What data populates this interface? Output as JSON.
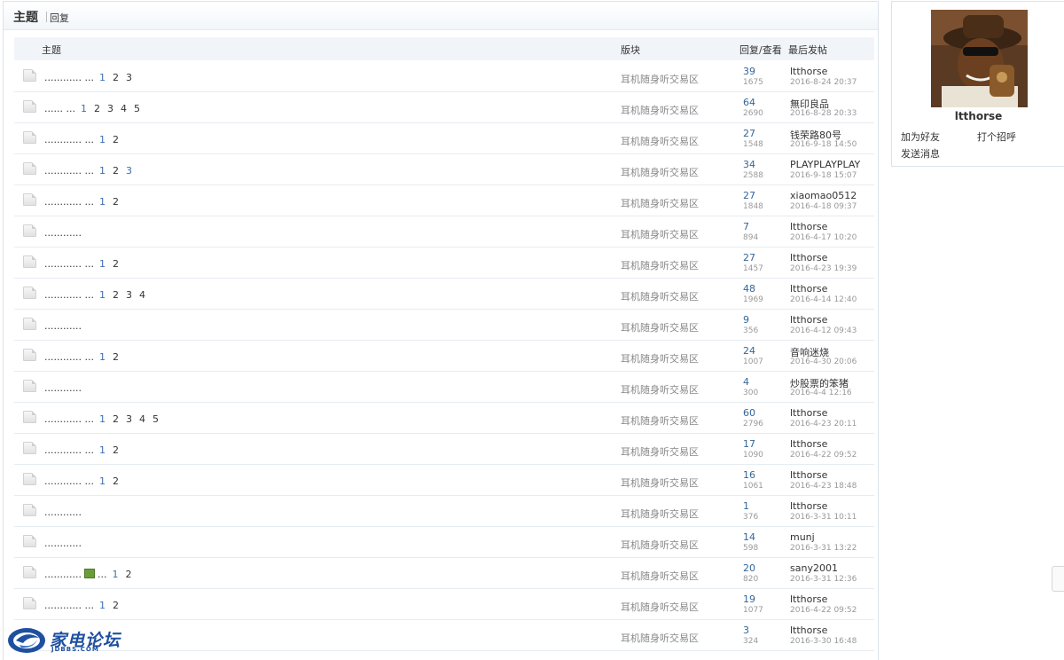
{
  "tabs": {
    "topic": "主题",
    "reply": "回复"
  },
  "columns": {
    "subject": "主题",
    "forum": "版块",
    "stats": "回复/查看",
    "last_post": "最后发帖"
  },
  "threads": [
    {
      "title": "............ ...",
      "pages": [
        "1",
        "2",
        "3"
      ],
      "forum": "耳机随身听交易区",
      "replies": "39",
      "views": "1675",
      "author": "ltthorse",
      "date": "2016-8-24 20:37"
    },
    {
      "title": "...... ...",
      "pages": [
        "1",
        "2",
        "3",
        "4",
        "5"
      ],
      "forum": "耳机随身听交易区",
      "replies": "64",
      "views": "2690",
      "author": "無印良品",
      "date": "2016-8-28 20:33"
    },
    {
      "title": "............ ...",
      "pages": [
        "1",
        "2"
      ],
      "forum": "耳机随身听交易区",
      "replies": "27",
      "views": "1548",
      "author": "钱荣路80号",
      "date": "2016-9-18 14:50"
    },
    {
      "title": "............ ...",
      "pages": [
        "1",
        "2",
        "3"
      ],
      "forum": "耳机随身听交易区",
      "replies": "34",
      "views": "2588",
      "author": "PLAYPLAYPLAY",
      "date": "2016-9-18 15:07"
    },
    {
      "title": "............ ...",
      "pages": [
        "1",
        "2"
      ],
      "forum": "耳机随身听交易区",
      "replies": "27",
      "views": "1848",
      "author": "xiaomao0512",
      "date": "2016-4-18 09:37"
    },
    {
      "title": "............",
      "pages": [],
      "forum": "耳机随身听交易区",
      "replies": "7",
      "views": "894",
      "author": "ltthorse",
      "date": "2016-4-17 10:20"
    },
    {
      "title": "............ ...",
      "pages": [
        "1",
        "2"
      ],
      "forum": "耳机随身听交易区",
      "replies": "27",
      "views": "1457",
      "author": "ltthorse",
      "date": "2016-4-23 19:39"
    },
    {
      "title": "............ ...",
      "pages": [
        "1",
        "2",
        "3",
        "4"
      ],
      "forum": "耳机随身听交易区",
      "replies": "48",
      "views": "1969",
      "author": "ltthorse",
      "date": "2016-4-14 12:40"
    },
    {
      "title": "............",
      "pages": [],
      "forum": "耳机随身听交易区",
      "replies": "9",
      "views": "356",
      "author": "ltthorse",
      "date": "2016-4-12 09:43"
    },
    {
      "title": "............ ...",
      "pages": [
        "1",
        "2"
      ],
      "forum": "耳机随身听交易区",
      "replies": "24",
      "views": "1007",
      "author": "音响迷烧",
      "date": "2016-4-30 20:06"
    },
    {
      "title": "............",
      "pages": [],
      "forum": "耳机随身听交易区",
      "replies": "4",
      "views": "300",
      "author": "炒股票的笨猪",
      "date": "2016-4-4 12:16"
    },
    {
      "title": "............ ...",
      "pages": [
        "1",
        "2",
        "3",
        "4",
        "5"
      ],
      "forum": "耳机随身听交易区",
      "replies": "60",
      "views": "2796",
      "author": "ltthorse",
      "date": "2016-4-23 20:11"
    },
    {
      "title": "............ ...",
      "pages": [
        "1",
        "2"
      ],
      "forum": "耳机随身听交易区",
      "replies": "17",
      "views": "1090",
      "author": "ltthorse",
      "date": "2016-4-22 09:52"
    },
    {
      "title": "............ ...",
      "pages": [
        "1",
        "2"
      ],
      "forum": "耳机随身听交易区",
      "replies": "16",
      "views": "1061",
      "author": "ltthorse",
      "date": "2016-4-23 18:48"
    },
    {
      "title": "............",
      "pages": [],
      "forum": "耳机随身听交易区",
      "replies": "1",
      "views": "376",
      "author": "ltthorse",
      "date": "2016-3-31 10:11"
    },
    {
      "title": "............",
      "pages": [],
      "forum": "耳机随身听交易区",
      "replies": "14",
      "views": "598",
      "author": "munj",
      "date": "2016-3-31 13:22"
    },
    {
      "title": "............",
      "title_after": "...",
      "attachment": true,
      "pages": [
        "1",
        "2"
      ],
      "forum": "耳机随身听交易区",
      "replies": "20",
      "views": "820",
      "author": "sany2001",
      "date": "2016-3-31 12:36"
    },
    {
      "title": "............ ...",
      "pages": [
        "1",
        "2"
      ],
      "forum": "耳机随身听交易区",
      "replies": "19",
      "views": "1077",
      "author": "ltthorse",
      "date": "2016-4-22 09:52"
    },
    {
      "title": "",
      "pages": [],
      "forum": "耳机随身听交易区",
      "replies": "3",
      "views": "324",
      "author": "ltthorse",
      "date": "2016-3-30 16:48"
    }
  ],
  "profile": {
    "username": "ltthorse",
    "add_friend": "加为好友",
    "greet": "打个招呼",
    "send_message": "发送消息"
  },
  "logo": {
    "name": "家电论坛",
    "domain": "JDBBS.COM"
  },
  "icons": {
    "thread": "folder-icon",
    "attachment": "image-attachment-icon"
  }
}
